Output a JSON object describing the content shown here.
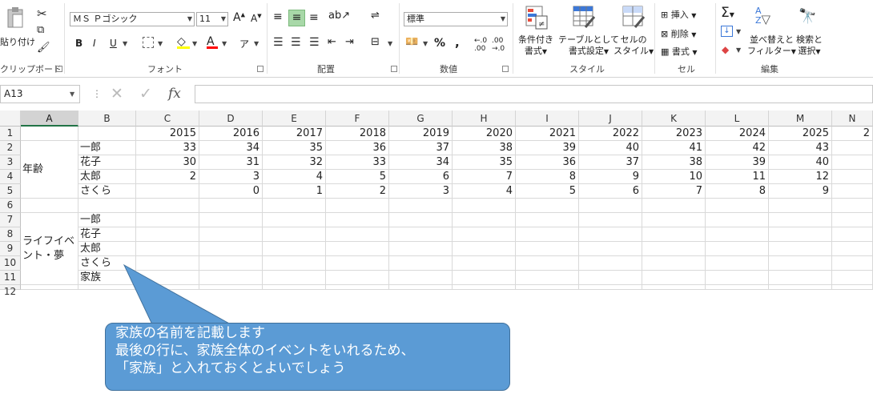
{
  "ribbon": {
    "clipboard": {
      "paste_label": "貼り付け",
      "group_label": "クリップボード"
    },
    "font": {
      "font_name": "ＭＳ Ｐゴシック",
      "font_size": "11",
      "bold": "B",
      "italic": "I",
      "underline": "U",
      "increase": "A",
      "decrease": "A",
      "font_color_letter": "A",
      "group_label": "フォント"
    },
    "alignment": {
      "group_label": "配置"
    },
    "number": {
      "format": "標準",
      "percent": "%",
      "comma": ",",
      "group_label": "数値"
    },
    "styles": {
      "conditional": [
        "条件付き",
        "書式"
      ],
      "table": [
        "テーブルとして",
        "書式設定"
      ],
      "cell": [
        "セルの",
        "スタイル"
      ],
      "group_label": "スタイル"
    },
    "cells": {
      "insert": "挿入",
      "delete": "削除",
      "format": "書式",
      "group_label": "セル"
    },
    "editing": {
      "sum": "Σ",
      "sort": [
        "並べ替えと",
        "フィルター"
      ],
      "find": [
        "検索と",
        "選択"
      ],
      "group_label": "編集"
    }
  },
  "formula_bar": {
    "name_box": "A13",
    "fx": "fx",
    "formula": ""
  },
  "sheet": {
    "columns": [
      "A",
      "B",
      "C",
      "D",
      "E",
      "F",
      "G",
      "H",
      "I",
      "J",
      "K",
      "L",
      "M",
      "N"
    ],
    "rows": [
      "1",
      "2",
      "3",
      "4",
      "5",
      "6",
      "7",
      "8",
      "9",
      "10",
      "11",
      "12"
    ],
    "years": [
      "2015",
      "2016",
      "2017",
      "2018",
      "2019",
      "2020",
      "2021",
      "2022",
      "2023",
      "2024",
      "2025",
      "2"
    ],
    "age_label": "年齢",
    "life_label_1": "ライフイベ",
    "life_label_2": "ント・夢",
    "age_names": [
      "一郎",
      "花子",
      "太郎",
      "さくら"
    ],
    "age_values": [
      [
        "33",
        "34",
        "35",
        "36",
        "37",
        "38",
        "39",
        "40",
        "41",
        "42",
        "43"
      ],
      [
        "30",
        "31",
        "32",
        "33",
        "34",
        "35",
        "36",
        "37",
        "38",
        "39",
        "40"
      ],
      [
        "2",
        "3",
        "4",
        "5",
        "6",
        "7",
        "8",
        "9",
        "10",
        "11",
        "12"
      ],
      [
        "",
        "0",
        "1",
        "2",
        "3",
        "4",
        "5",
        "6",
        "7",
        "8",
        "9"
      ]
    ],
    "life_names": [
      "一郎",
      "花子",
      "太郎",
      "さくら",
      "家族"
    ]
  },
  "callout": {
    "line1": "家族の名前を記載します",
    "line2": "最後の行に、家族全体のイベントをいれるため、",
    "line3": "「家族」と入れておくとよいでしょう"
  },
  "colors": {
    "accent": "#217346",
    "callout_fill": "#5b9bd5",
    "callout_border": "#41719c"
  }
}
